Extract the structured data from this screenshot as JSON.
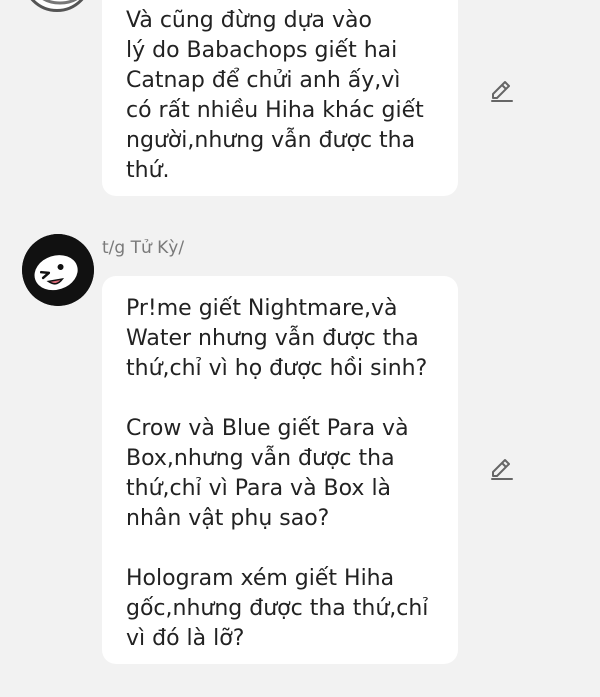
{
  "messages": [
    {
      "author": "",
      "paragraphs": [
        "Và cũng đừng dựa vào\nlý do Babachops giết hai\nCatnap để chửi anh ấy,vì\ncó rất nhiều Hiha khác giết\nngười,nhưng vẫn được tha\nthứ."
      ],
      "action_icon": "pencil-edit-icon"
    },
    {
      "author": "t/g Tử Kỳ/",
      "paragraphs": [
        "Pr!me giết Nightmare,và\nWater nhưng vẫn được tha\nthứ,chỉ vì họ được hồi sinh?",
        "Crow và Blue giết Para và\nBox,nhưng vẫn được tha\nthứ,chỉ vì Para và Box là\nnhân vật phụ sao?",
        "Hologram xém giết Hiha\ngốc,nhưng được tha thứ,chỉ\nvì đó là lỡ?"
      ],
      "action_icon": "pencil-edit-icon"
    }
  ],
  "colors": {
    "background": "#f2f2f2",
    "bubble": "#ffffff",
    "text": "#222222",
    "author": "#7a7a7a",
    "icon": "#666666"
  }
}
